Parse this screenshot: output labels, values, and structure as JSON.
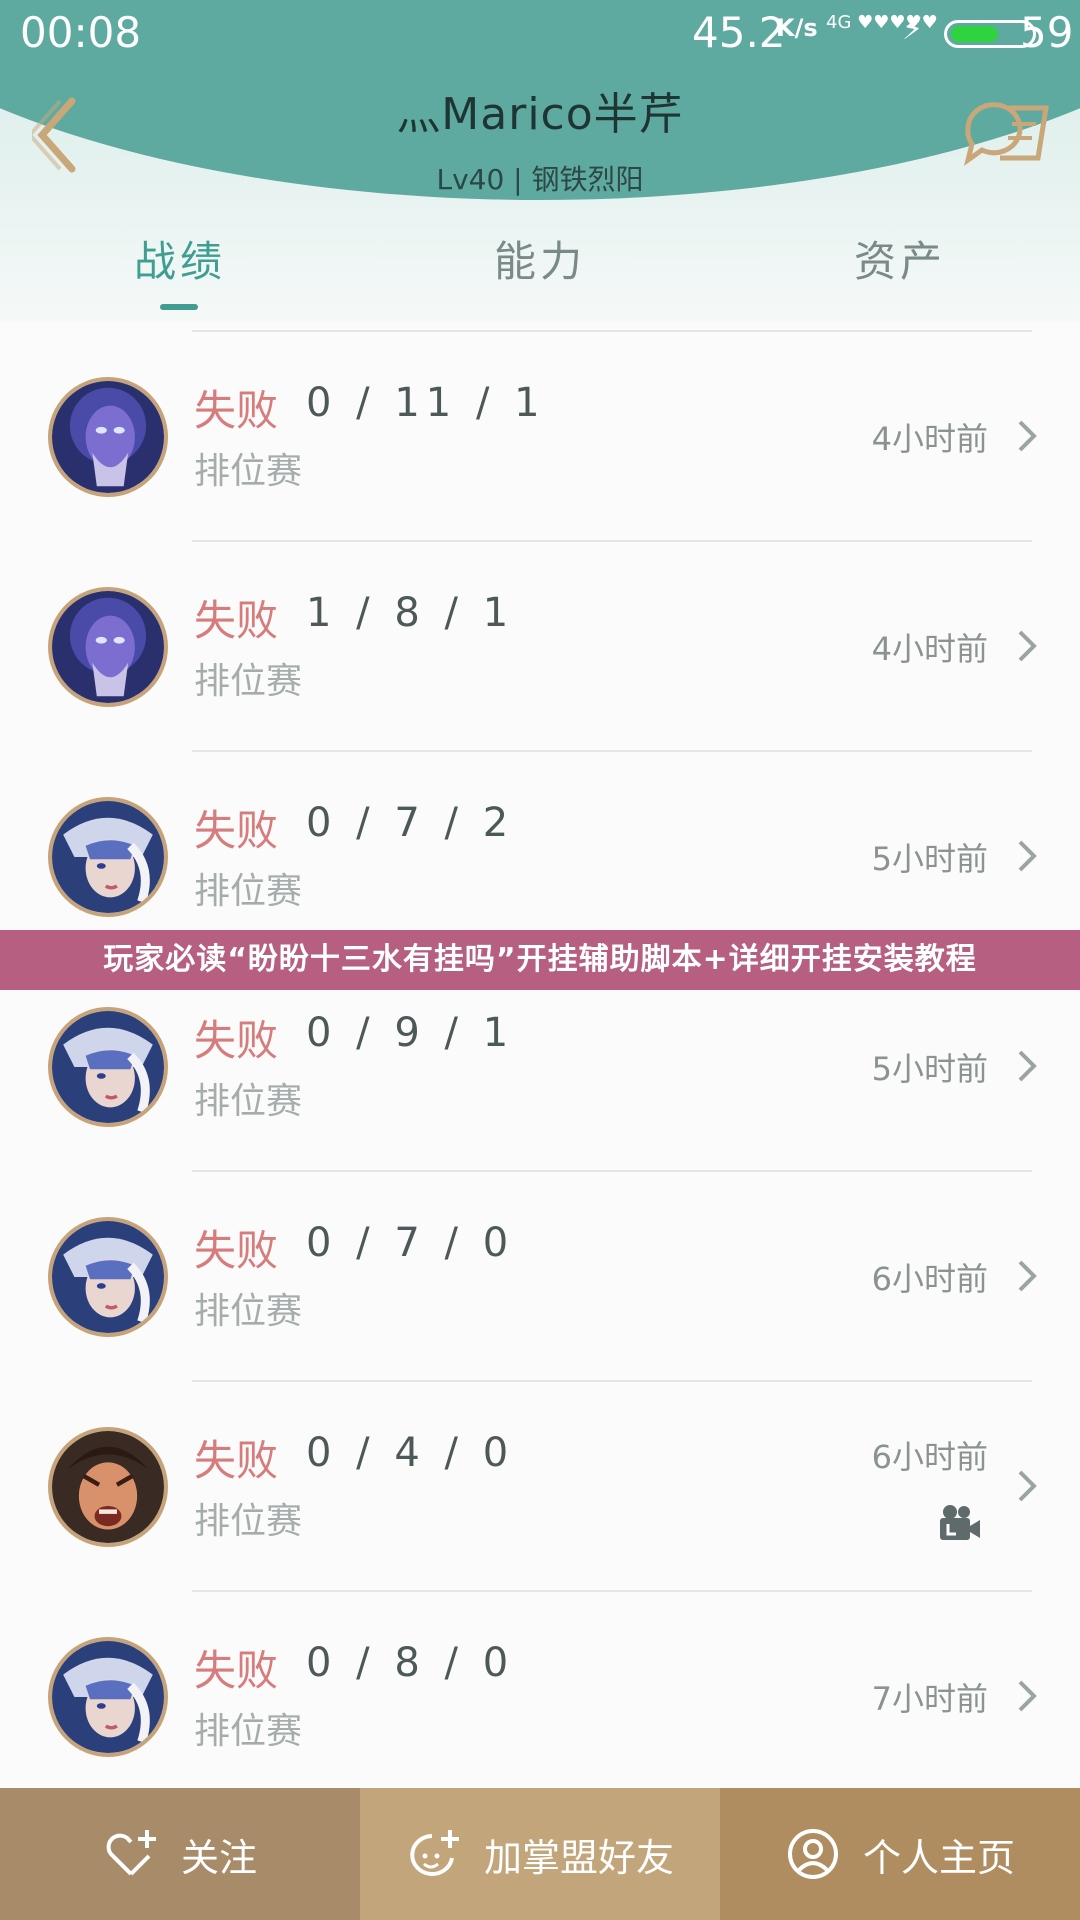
{
  "status_bar": {
    "time": "00:08",
    "speed": "45.2",
    "speed_unit": "K/s",
    "network": "4G",
    "battery_level": 59,
    "battery_text": "59",
    "battery_color": "#2fd23f"
  },
  "header": {
    "title": "灬Marico半芹",
    "subtitle": "Lv40 | 钢铁烈阳",
    "back_icon": "back-arrow-icon",
    "message_icon": "message-list-icon"
  },
  "tabs": [
    {
      "label": "战绩",
      "active": true
    },
    {
      "label": "能力",
      "active": false
    },
    {
      "label": "资产",
      "active": false
    }
  ],
  "matches": [
    {
      "result": "失败",
      "kda": "0 / 11 / 1",
      "mode": "排位赛",
      "time": "4小时前",
      "hero": "hero-purple-mage-avatar",
      "video": false
    },
    {
      "result": "失败",
      "kda": "1 / 8 / 1",
      "mode": "排位赛",
      "time": "4小时前",
      "hero": "hero-purple-mage-avatar",
      "video": false
    },
    {
      "result": "失败",
      "kda": "0 / 7 / 2",
      "mode": "排位赛",
      "time": "5小时前",
      "hero": "hero-archer-avatar",
      "video": false
    },
    {
      "result": "失败",
      "kda": "0 / 9 / 1",
      "mode": "排位赛",
      "time": "5小时前",
      "hero": "hero-archer-avatar",
      "video": false
    },
    {
      "result": "失败",
      "kda": "0 / 7 / 0",
      "mode": "排位赛",
      "time": "6小时前",
      "hero": "hero-archer-avatar",
      "video": false
    },
    {
      "result": "失败",
      "kda": "0 / 4 / 0",
      "mode": "排位赛",
      "time": "6小时前",
      "hero": "hero-warrior-avatar",
      "video": true
    },
    {
      "result": "失败",
      "kda": "0 / 8 / 0",
      "mode": "排位赛",
      "time": "7小时前",
      "hero": "hero-archer-avatar",
      "video": false
    }
  ],
  "banner": "玩家必读“盼盼十三水有挂吗”开挂辅助脚本+详细开挂安装教程",
  "bottom_bar": {
    "follow": "关注",
    "add_friend": "加掌盟好友",
    "homepage": "个人主页"
  },
  "colors": {
    "header_teal": "#5faaa0",
    "tab_active": "#3f9d92",
    "loss_red": "#d77c7c",
    "banner_bg": "#b65f80",
    "btn_follow": "#a88c6a",
    "btn_friend": "#c2a57b",
    "btn_home": "#b08d61"
  }
}
